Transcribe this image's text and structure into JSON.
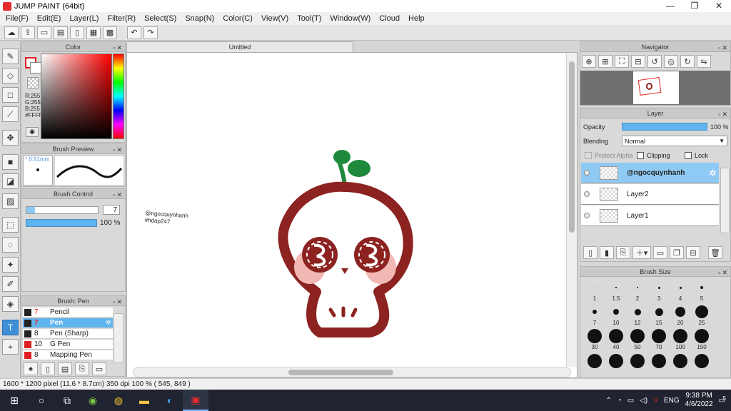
{
  "window": {
    "title": "JUMP PAINT (64bit)",
    "controls": [
      "—",
      "❐",
      "✕"
    ]
  },
  "menu": [
    "File(F)",
    "Edit(E)",
    "Layer(L)",
    "Filter(R)",
    "Select(S)",
    "Snap(N)",
    "Color(C)",
    "View(V)",
    "Tool(T)",
    "Window(W)",
    "Cloud",
    "Help"
  ],
  "color_panel": {
    "title": "Color",
    "r": "R:255",
    "g": "G:255",
    "b": "B:255",
    "hex": "#FFFFFF"
  },
  "brush_preview": {
    "title": "Brush Preview",
    "size": "* 0.51mm"
  },
  "brush_control": {
    "title": "Brush Control",
    "size_value": "7",
    "opacity_value": "100 %"
  },
  "brush_list": {
    "title": "Brush: Pen",
    "items": [
      {
        "num": "7",
        "name": "Pencil",
        "color": "#222222"
      },
      {
        "num": "7",
        "name": "Pen",
        "color": "#222222"
      },
      {
        "num": "8",
        "name": "Pen (Sharp)",
        "color": "#222222"
      },
      {
        "num": "10",
        "name": "G Pen",
        "color": "#e02020"
      },
      {
        "num": "8",
        "name": "Mapping Pen",
        "color": "#e02020"
      }
    ]
  },
  "canvas": {
    "tab": "Untitled",
    "watermark_line1": "@ngocquynhanh",
    "watermark_line2": "#hdap247",
    "colors": {
      "outline": "#8c2321",
      "leaf": "#1e8a3c",
      "blush": "#f2b8b4"
    }
  },
  "navigator": {
    "title": "Navigator"
  },
  "layer_panel": {
    "title": "Layer",
    "opacity_label": "Opacity",
    "opacity_value": "100 %",
    "blending_label": "Blending",
    "blending_value": "Normal",
    "protect_alpha": "Protect Alpha",
    "clipping": "Clipping",
    "lock": "Lock",
    "layers": [
      {
        "name": "@ngocquynhanh"
      },
      {
        "name": "Layer2"
      },
      {
        "name": "Layer1"
      }
    ]
  },
  "brush_size": {
    "title": "Brush Size",
    "labels": [
      "1",
      "1.5",
      "2",
      "3",
      "4",
      "5",
      "7",
      "10",
      "12",
      "15",
      "20",
      "25",
      "30",
      "40",
      "50",
      "70",
      "100",
      "150"
    ]
  },
  "status": {
    "text": "1600 * 1200 pixel   (11.6 * 8.7cm)   350 dpi   100 %   ( 545, 849 )"
  },
  "taskbar": {
    "lang": "ENG",
    "time": "9:38 PM",
    "date": "4/6/2022",
    "notif": "5"
  }
}
